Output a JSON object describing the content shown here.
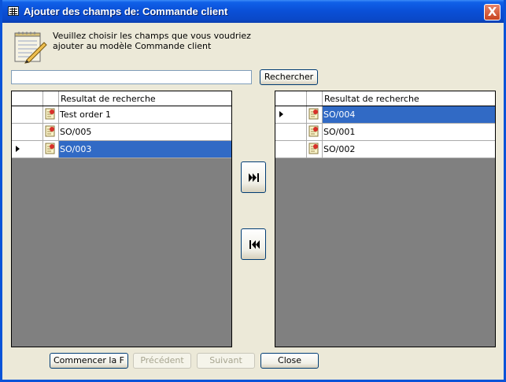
{
  "window": {
    "title": "Ajouter des champs de:  Commande client",
    "close_label": "X"
  },
  "description": {
    "line1": "Veuillez choisir les champs que vous voudriez",
    "line2": "ajouter au modèle Commande client"
  },
  "search": {
    "value": "",
    "button_label": "Rechercher"
  },
  "left_grid": {
    "header": "Resultat de recherche",
    "rows": [
      {
        "label": "Test order 1",
        "current": false,
        "selected": false
      },
      {
        "label": "SO/005",
        "current": false,
        "selected": false
      },
      {
        "label": "SO/003",
        "current": true,
        "selected": true
      }
    ]
  },
  "right_grid": {
    "header": "Resultat de recherche",
    "rows": [
      {
        "label": "SO/004",
        "current": true,
        "selected": true
      },
      {
        "label": "SO/001",
        "current": false,
        "selected": false
      },
      {
        "label": "SO/002",
        "current": false,
        "selected": false
      }
    ]
  },
  "move_buttons": {
    "add_icon": "move-all-right-icon",
    "remove_icon": "move-all-left-icon"
  },
  "footer": {
    "start": "Commencer  la F",
    "previous": "Précédent",
    "next": "Suivant",
    "close": "Close"
  }
}
